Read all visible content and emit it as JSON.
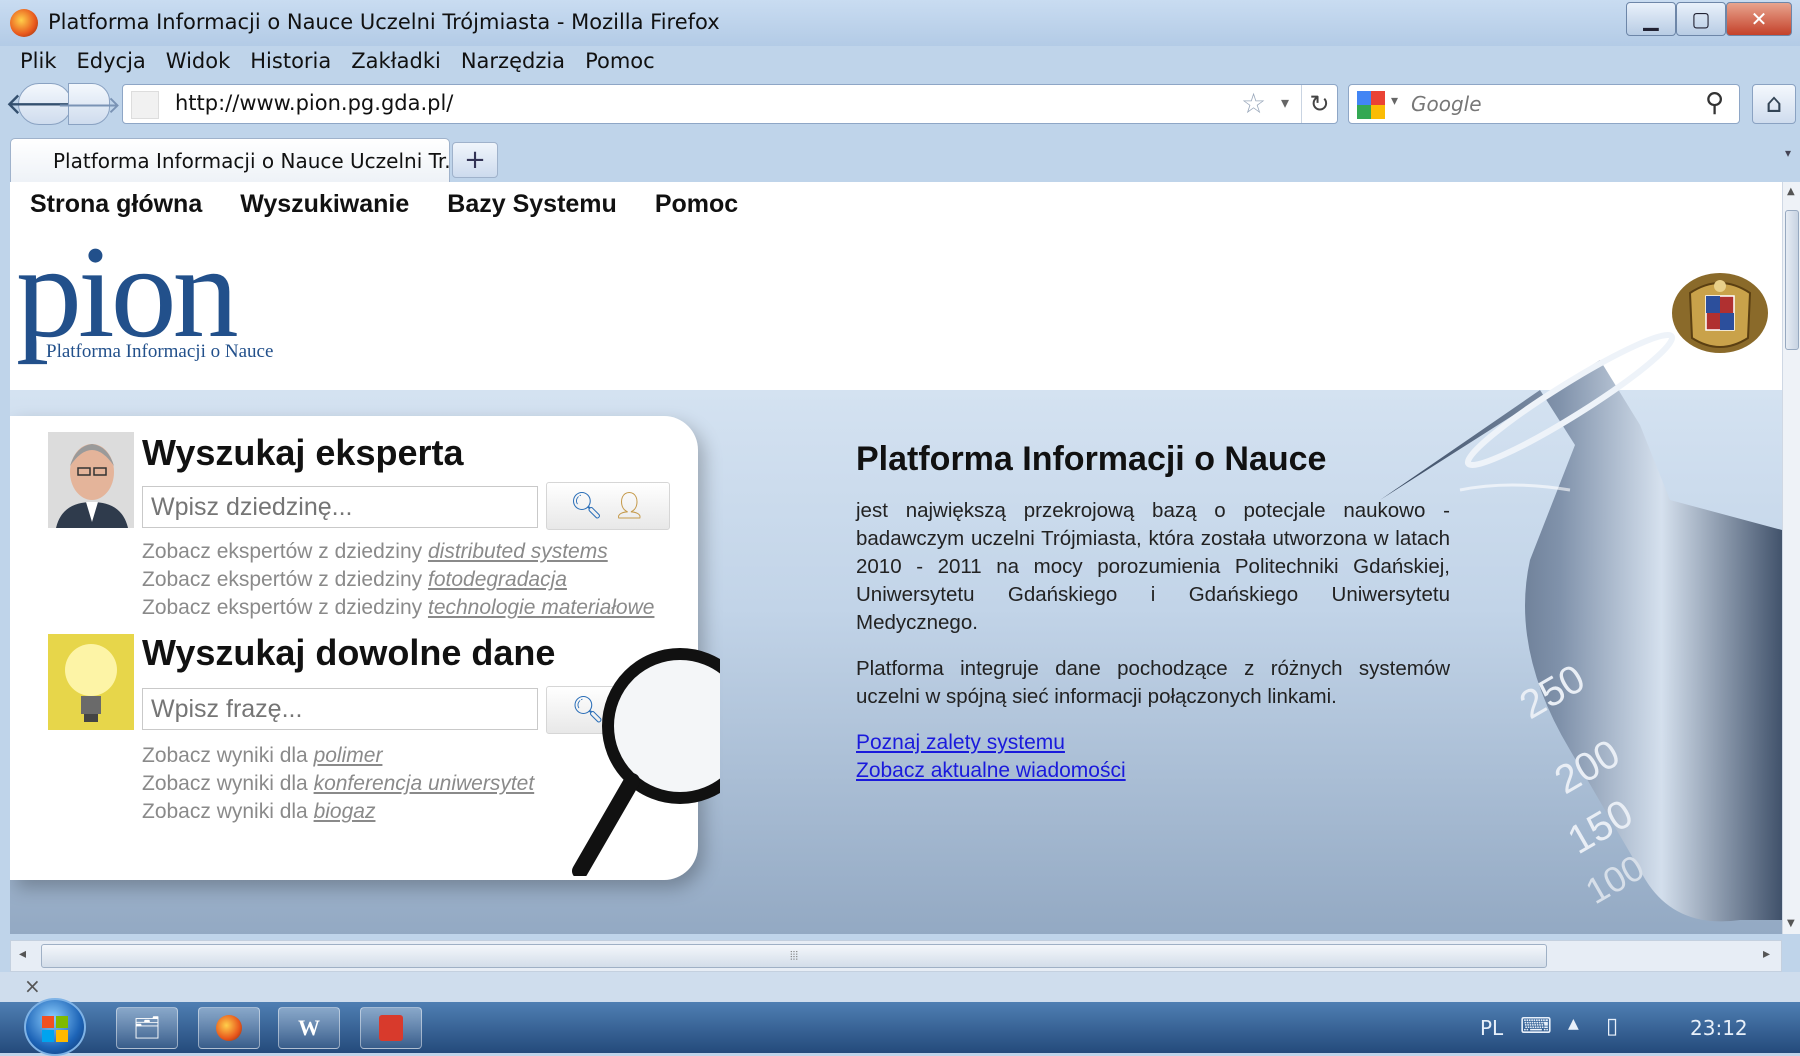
{
  "window": {
    "title": "Platforma Informacji o Nauce Uczelni Trójmiasta - Mozilla Firefox"
  },
  "menu": [
    "Plik",
    "Edycja",
    "Widok",
    "Historia",
    "Zakładki",
    "Narzędzia",
    "Pomoc"
  ],
  "navbar": {
    "url": "http://www.pion.pg.gda.pl/",
    "search_placeholder": "Google"
  },
  "tab": {
    "title": "Platforma Informacji o Nauce Uczelni Tr...",
    "new_tab": "+"
  },
  "site_nav": [
    "Strona główna",
    "Wyszukiwanie",
    "Bazy Systemu",
    "Pomoc"
  ],
  "logo": {
    "wordmark": "pion",
    "subtitle": "Platforma Informacji o Nauce"
  },
  "expert_search": {
    "title": "Wyszukaj eksperta",
    "placeholder": "Wpisz dziedzinę...",
    "suggestions": [
      {
        "prefix": "Zobacz ekspertów z dziedziny",
        "link": "distributed systems"
      },
      {
        "prefix": "Zobacz ekspertów z dziedziny",
        "link": "fotodegradacja"
      },
      {
        "prefix": "Zobacz ekspertów z dziedziny",
        "link": "technologie materiałowe"
      }
    ]
  },
  "data_search": {
    "title": "Wyszukaj dowolne dane",
    "placeholder": "Wpisz frazę...",
    "suggestions": [
      {
        "prefix": "Zobacz wyniki dla",
        "link": "polimer"
      },
      {
        "prefix": "Zobacz wyniki dla",
        "link": "konferencja uniwersytet"
      },
      {
        "prefix": "Zobacz wyniki dla",
        "link": "biogaz"
      }
    ]
  },
  "info": {
    "title": "Platforma Informacji o Nauce",
    "paragraph1": "jest największą przekrojową bazą o potecjale naukowo - badawczym uczelni Trójmiasta, która została utworzona w latach 2010 - 2011 na mocy porozumienia Politechniki Gdańskiej, Uniwersytetu Gdańskiego i Gdańskiego Uniwersytetu Medycznego.",
    "paragraph2": "Platforma integruje dane pochodzące z różnych systemów uczelni w spójną sieć informacji połączonych linkami.",
    "link1": "Poznaj zalety systemu",
    "link2": "Zobacz aktualne wiadomości"
  },
  "flask_marks": [
    "250",
    "200",
    "150",
    "100"
  ],
  "statusbar": {
    "close": "×"
  },
  "taskbar": {
    "language": "PL",
    "clock": "23:12"
  },
  "colors": {
    "logo_blue": "#22508b",
    "link_blue": "#1a1adc",
    "taskbar": "#2f5c92"
  }
}
